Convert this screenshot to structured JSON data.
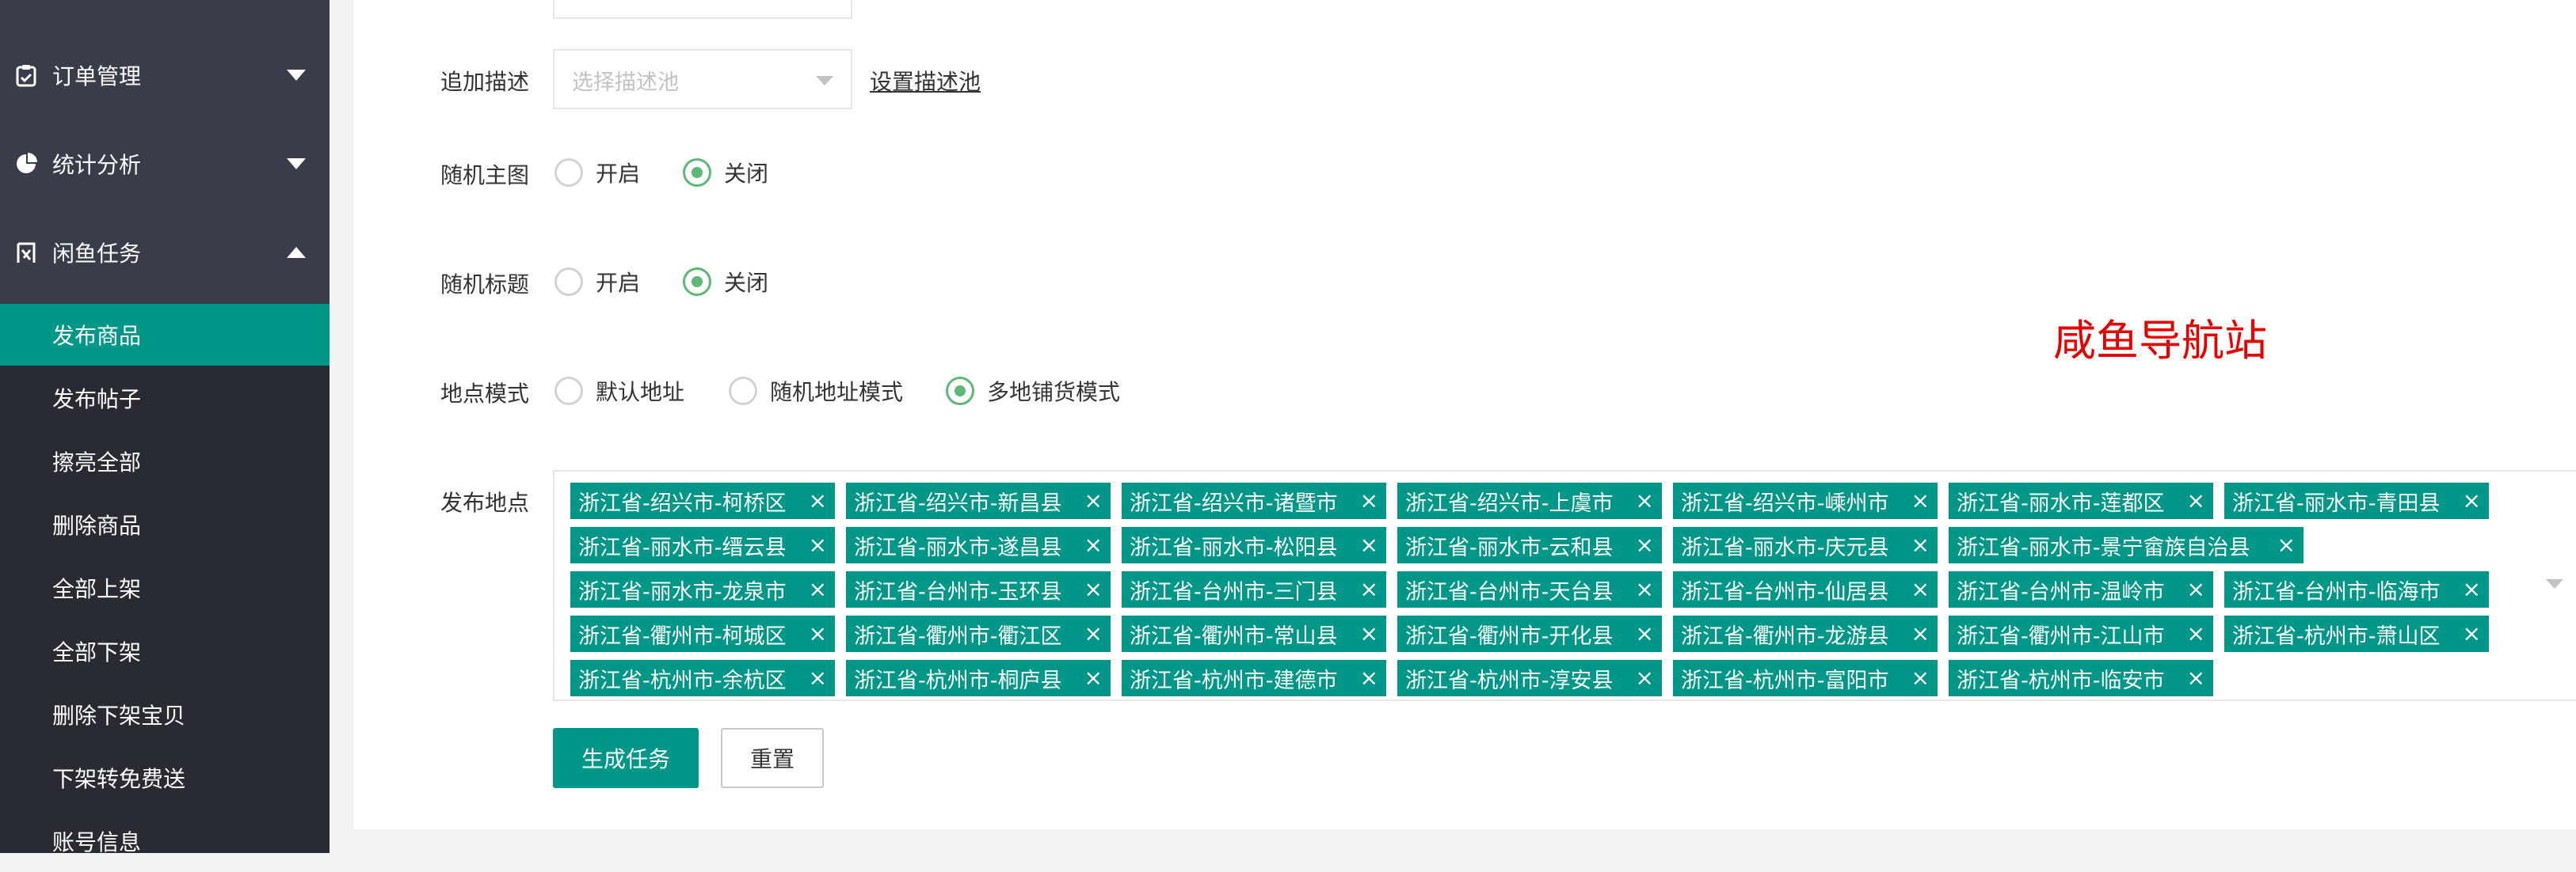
{
  "sidebar": {
    "menus": [
      {
        "label": "订单管理",
        "icon": "clipboard-icon",
        "expanded": false
      },
      {
        "label": "统计分析",
        "icon": "pie-chart-icon",
        "expanded": false
      },
      {
        "label": "闲鱼任务",
        "icon": "xianyu-icon",
        "expanded": true
      }
    ],
    "submenu": [
      {
        "label": "发布商品",
        "active": true
      },
      {
        "label": "发布帖子",
        "active": false
      },
      {
        "label": "擦亮全部",
        "active": false
      },
      {
        "label": "删除商品",
        "active": false
      },
      {
        "label": "全部上架",
        "active": false
      },
      {
        "label": "全部下架",
        "active": false
      },
      {
        "label": "删除下架宝贝",
        "active": false
      },
      {
        "label": "下架转免费送",
        "active": false
      },
      {
        "label": "账号信息",
        "active": false
      }
    ]
  },
  "form": {
    "append_desc": {
      "label": "追加描述",
      "placeholder": "选择描述池",
      "link": "设置描述池"
    },
    "random_main_image": {
      "label": "随机主图",
      "options": [
        "开启",
        "关闭"
      ],
      "selected": "关闭"
    },
    "random_title": {
      "label": "随机标题",
      "options": [
        "开启",
        "关闭"
      ],
      "selected": "关闭"
    },
    "location_mode": {
      "label": "地点模式",
      "options": [
        "默认地址",
        "随机地址模式",
        "多地铺货模式"
      ],
      "selected": "多地铺货模式"
    },
    "publish_locations": {
      "label": "发布地点",
      "tags": [
        "浙江省-绍兴市-柯桥区",
        "浙江省-绍兴市-新昌县",
        "浙江省-绍兴市-诸暨市",
        "浙江省-绍兴市-上虞市",
        "浙江省-绍兴市-嵊州市",
        "浙江省-丽水市-莲都区",
        "浙江省-丽水市-青田县",
        "浙江省-丽水市-缙云县",
        "浙江省-丽水市-遂昌县",
        "浙江省-丽水市-松阳县",
        "浙江省-丽水市-云和县",
        "浙江省-丽水市-庆元县",
        "浙江省-丽水市-景宁畲族自治县",
        "浙江省-丽水市-龙泉市",
        "浙江省-台州市-玉环县",
        "浙江省-台州市-三门县",
        "浙江省-台州市-天台县",
        "浙江省-台州市-仙居县",
        "浙江省-台州市-温岭市",
        "浙江省-台州市-临海市",
        "浙江省-衢州市-柯城区",
        "浙江省-衢州市-衢江区",
        "浙江省-衢州市-常山县",
        "浙江省-衢州市-开化县",
        "浙江省-衢州市-龙游县",
        "浙江省-衢州市-江山市",
        "浙江省-杭州市-萧山区",
        "浙江省-杭州市-余杭区",
        "浙江省-杭州市-桐庐县",
        "浙江省-杭州市-建德市",
        "浙江省-杭州市-淳安县",
        "浙江省-杭州市-富阳市",
        "浙江省-杭州市-临安市"
      ],
      "close_glyph": "×"
    },
    "buttons": {
      "generate": "生成任务",
      "reset": "重置"
    }
  },
  "watermark": "咸鱼导航站",
  "colors": {
    "sidebar_bg": "#393d49",
    "submenu_bg": "#282b33",
    "accent": "#009688",
    "radio_checked": "#5fb878",
    "watermark": "#e60000"
  }
}
